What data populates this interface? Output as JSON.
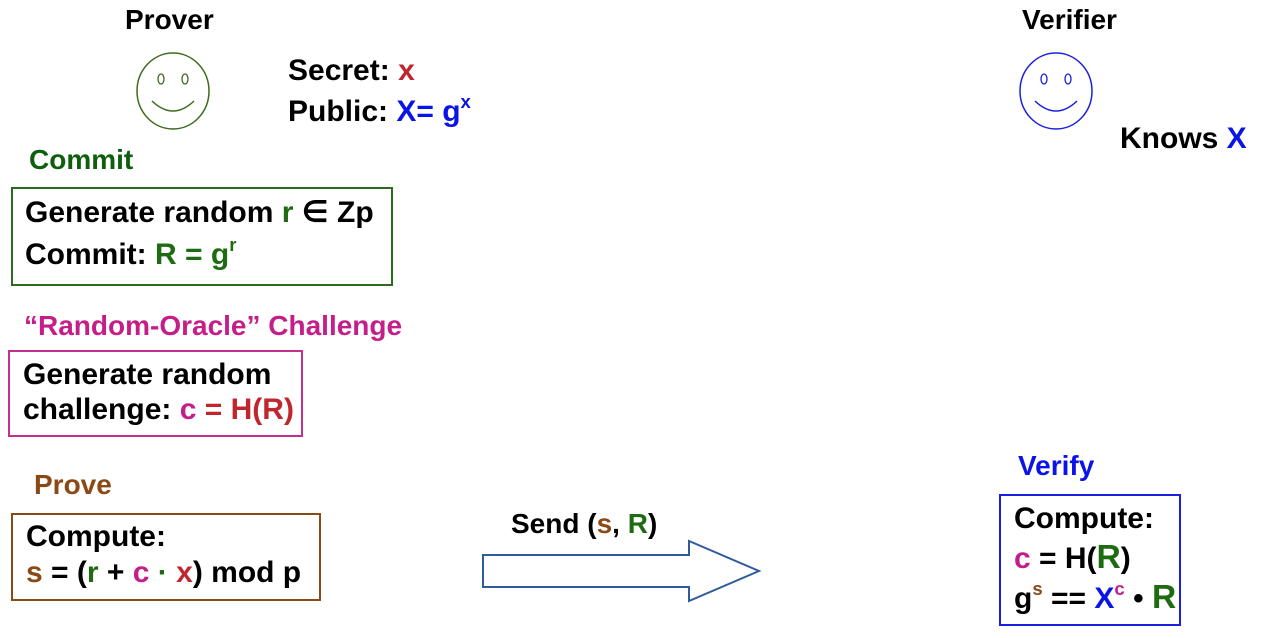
{
  "colors": {
    "red": "#c0262d",
    "blue": "#0a14e6",
    "green": "#1e6b12",
    "dark_green": "#0d5e0d",
    "magenta": "#c41e8a",
    "brown": "#8a4a16",
    "box_green": "#2c6b1f",
    "box_magenta": "#c4308f",
    "box_brown": "#8a4a16",
    "box_blue": "#1a1fe0",
    "arrow": "#2e5c9a",
    "prover_face": "#3d6b1e",
    "verifier_face": "#1a1fe0"
  },
  "prover": {
    "title": "Prover",
    "secret_label": "Secret: ",
    "secret_value": "x",
    "public_label": "Public: ",
    "public_X": "X",
    "public_eq": "= g",
    "public_exp": "x"
  },
  "verifier": {
    "title": "Verifier",
    "knows_label": "Knows ",
    "knows_value": "X"
  },
  "commit": {
    "heading": "Commit",
    "line1_a": "Generate random ",
    "line1_r": "r",
    "line1_b": " ∈ Zp",
    "line2_a": "Commit: ",
    "line2_b": "R = g",
    "line2_exp": "r"
  },
  "challenge": {
    "heading": "“Random-Oracle” Challenge",
    "line1": "Generate random",
    "line2_a": "challenge: ",
    "line2_c": "c",
    "line2_eq": " = H(",
    "line2_R": "R",
    "line2_close": ")"
  },
  "prove": {
    "heading": "Prove",
    "line1": "Compute:",
    "s": "s",
    "eq_open": " = (",
    "r": "r",
    "plus": " + ",
    "c": "c",
    "dot": " · ",
    "x": "x",
    "close": ") mod p"
  },
  "send": {
    "label_a": "Send (",
    "s": "s",
    "comma": ", ",
    "R": "R",
    "close": ")"
  },
  "verify": {
    "heading": "Verify",
    "line1": "Compute:",
    "c": "c",
    "eq_H": " = H(",
    "R": "R",
    "close": ")",
    "g": "g",
    "g_exp": "s",
    "eqeq": " == ",
    "X": "X",
    "X_exp": "c",
    "dot": " • ",
    "R2": "R"
  }
}
